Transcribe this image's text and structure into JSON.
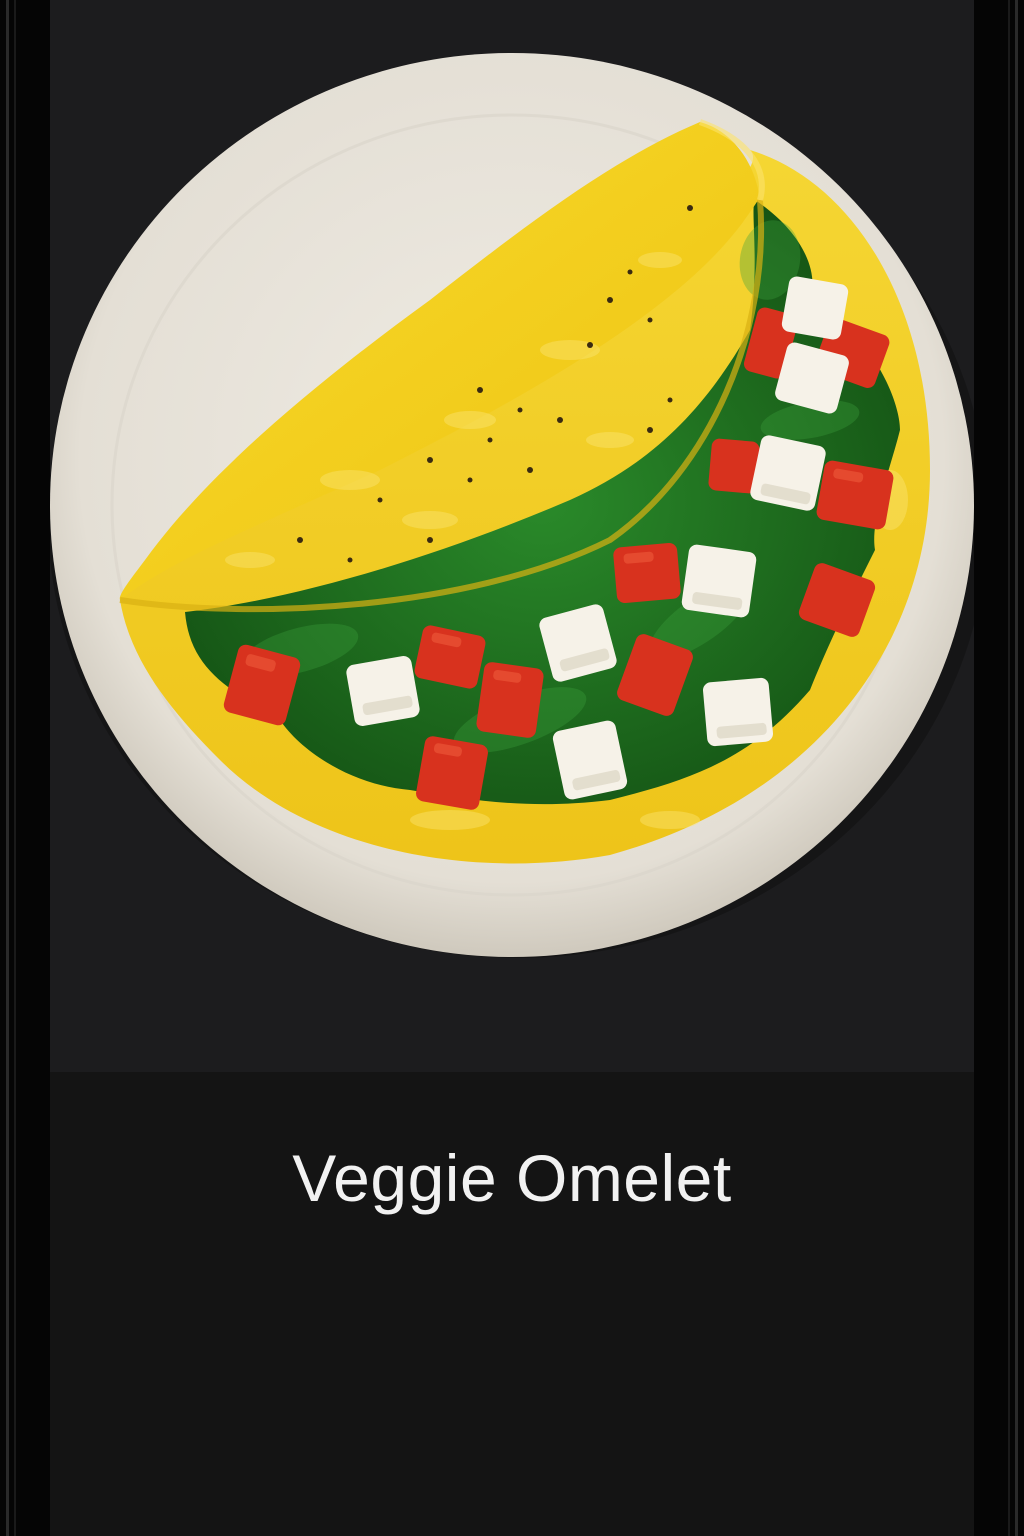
{
  "card": {
    "title": "Veggie Omelet"
  },
  "photo": {
    "subject": "omelet-plate",
    "colors": {
      "background": "#1c1c1e",
      "plate": "#e8e4dc",
      "egg": "#f2cf1f",
      "spinach": "#1f6b1f",
      "tomato": "#d8321e",
      "cheese": "#f6f2e8"
    }
  }
}
